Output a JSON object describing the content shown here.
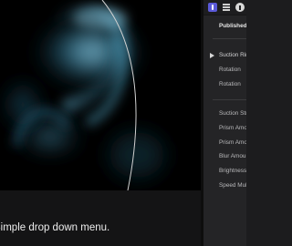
{
  "caption": {
    "text": "Simple drop down menu."
  },
  "inspector": {
    "tabs": [
      {
        "icon": "info-icon"
      },
      {
        "icon": "layers-icon"
      },
      {
        "icon": "help-icon"
      }
    ],
    "published_label": "Published",
    "group_label": "Suction Ring",
    "group_rows": [
      "Rotation",
      "Rotation"
    ],
    "properties": [
      "Suction Strength",
      "Prism Amount",
      "Prism Amount",
      "Blur Amount",
      "Brightness",
      "Speed Multiplier"
    ]
  },
  "colors": {
    "accent": "#5a59d8",
    "viewer_background": "#000000",
    "panel_background": "#242426"
  }
}
